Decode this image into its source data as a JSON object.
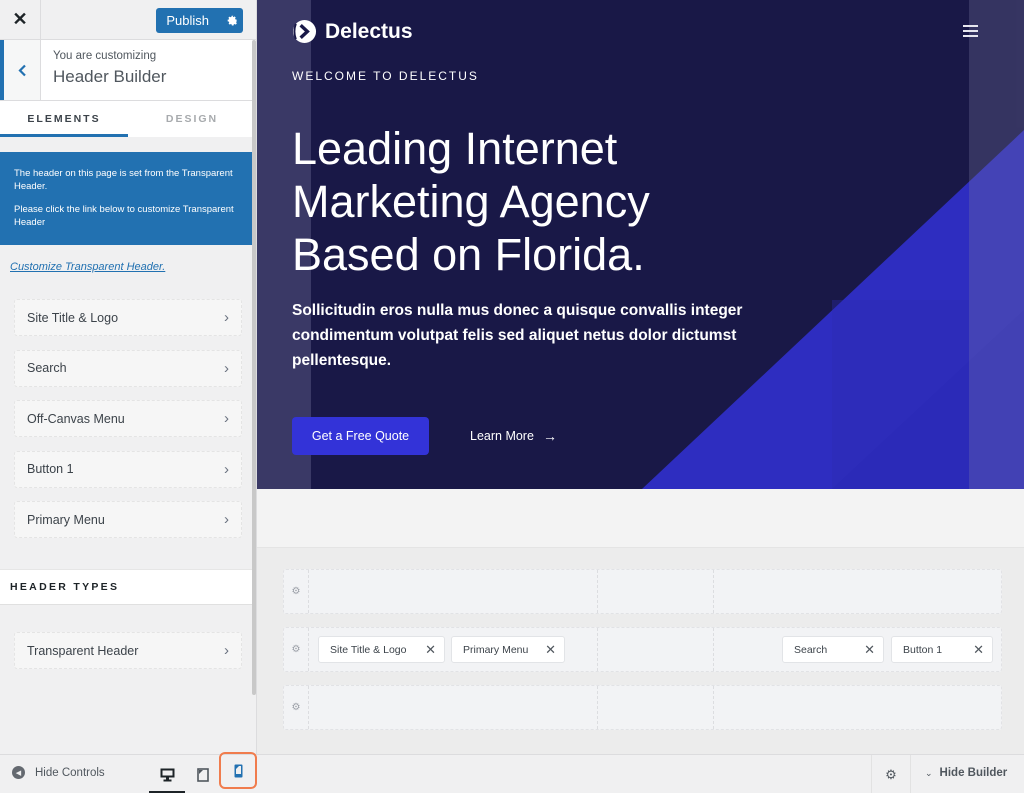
{
  "sidebar": {
    "close_icon": "✕",
    "publish_label": "Publish",
    "publish_settings_icon": "gear-icon",
    "back_icon": "chevron-left-icon",
    "customizing_label": "You are customizing",
    "section_title": "Header Builder",
    "tabs": [
      {
        "label": "ELEMENTS",
        "active": true
      },
      {
        "label": "DESIGN",
        "active": false
      }
    ],
    "notice": {
      "line1": "The header on this page is set from the Transparent Header.",
      "line2": "Please click the link below to customize Transparent Header"
    },
    "customize_link": "Customize Transparent Header.",
    "elements": [
      {
        "label": "Site Title & Logo"
      },
      {
        "label": "Search"
      },
      {
        "label": "Off-Canvas Menu"
      },
      {
        "label": "Button 1"
      },
      {
        "label": "Primary Menu"
      }
    ],
    "header_types_heading": "HEADER TYPES",
    "header_types": [
      {
        "label": "Transparent Header"
      }
    ]
  },
  "footer": {
    "hide_controls_label": "Hide Controls",
    "devices": [
      {
        "name": "desktop",
        "active": true
      },
      {
        "name": "tablet",
        "active": false
      },
      {
        "name": "mobile",
        "highlighted": true
      }
    ],
    "hide_builder_label": "Hide Builder"
  },
  "preview": {
    "brand_name": "Delectus",
    "eyebrow": "WELCOME TO DELECTUS",
    "title": "Leading Internet Marketing Agency Based on Florida.",
    "text": "Sollicitudin eros nulla mus donec a quisque convallis integer condimentum volutpat felis sed aliquet netus dolor dictumst pellentesque.",
    "cta_label": "Get a Free Quote",
    "learn_more_label": "Learn More",
    "colors": {
      "hero_bg": "#191847",
      "accent": "#3333d8"
    }
  },
  "builder": {
    "rows": [
      {
        "name": "top",
        "chips": []
      },
      {
        "name": "main",
        "chips": [
          {
            "label": "Site Title & Logo",
            "zone": "left"
          },
          {
            "label": "Primary Menu",
            "zone": "left"
          },
          {
            "label": "Search",
            "zone": "right"
          },
          {
            "label": "Button 1",
            "zone": "right"
          }
        ]
      },
      {
        "name": "bottom",
        "chips": []
      }
    ],
    "remove_icon": "✕"
  },
  "colors": {
    "wp_blue": "#2271b1",
    "highlight_orange": "#f07c4d"
  }
}
